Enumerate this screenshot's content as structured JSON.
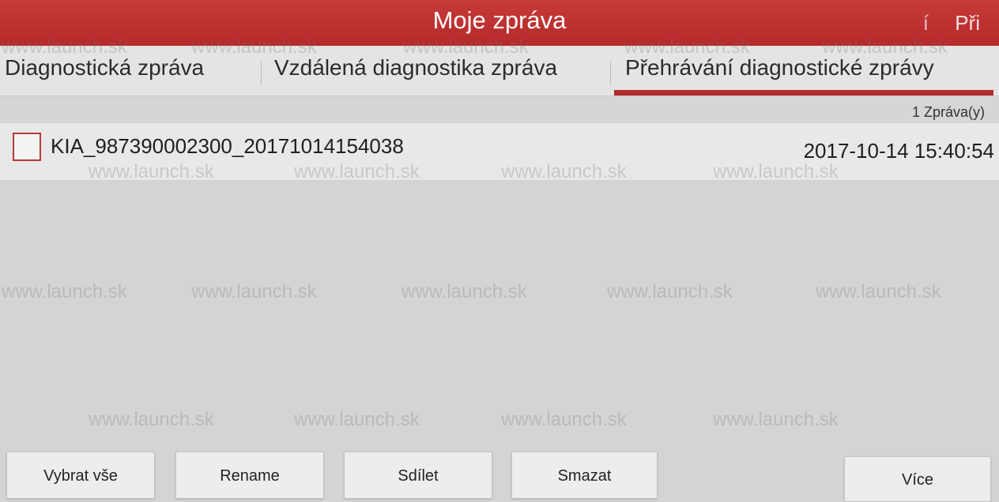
{
  "header": {
    "title": "Moje zpráva",
    "right_partial": "Při",
    "right_separator": "í"
  },
  "tabs": [
    {
      "label": "Diagnostická zpráva",
      "active": false
    },
    {
      "label": "Vzdálená diagnostika zpráva",
      "active": false
    },
    {
      "label": "Přehrávání diagnostické zprávy",
      "active": true
    }
  ],
  "report_count": "1 Zpráva(y)",
  "reports": [
    {
      "name": "KIA_987390002300_20171014154038",
      "date": "2017-10-14 15:40:54",
      "checked": false
    }
  ],
  "buttons": {
    "select_all": "Vybrat vše",
    "rename": "Rename",
    "share": "Sdílet",
    "delete": "Smazat",
    "more": "Více"
  },
  "watermark": "www.launch.sk",
  "colors": {
    "accent": "#b42a2a",
    "header_bg": "#c0333a",
    "background": "#d6d6d6"
  }
}
